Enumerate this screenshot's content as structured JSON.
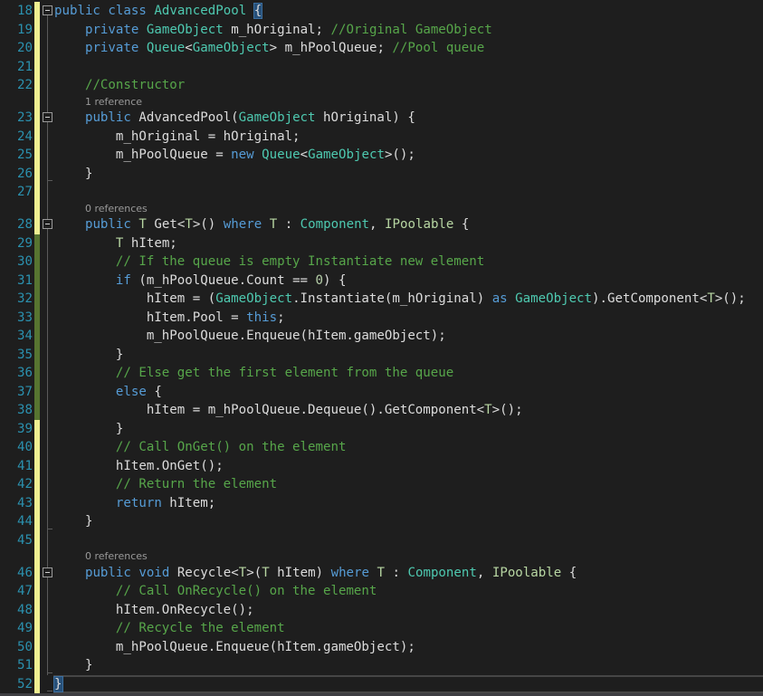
{
  "colors": {
    "keyword": "#569cd6",
    "type": "#4ec9b0",
    "type_param": "#b8d7a3",
    "comment": "#57a64a",
    "number": "#b5cea8",
    "text": "#dcdcdc",
    "line_number": "#2b91af",
    "margin_changed": "#efef91",
    "margin_saved": "#577430"
  },
  "lines": [
    {
      "n": "18",
      "m": "y",
      "fold": "box",
      "t": [
        [
          "kw",
          "public"
        ],
        [
          "",
          " "
        ],
        [
          "kw",
          "class"
        ],
        [
          "",
          " "
        ],
        [
          "ty",
          "AdvancedPool"
        ],
        [
          "",
          " "
        ],
        [
          "hl",
          "{"
        ]
      ]
    },
    {
      "n": "19",
      "m": "y",
      "t": [
        [
          "",
          "    "
        ],
        [
          "kw",
          "private"
        ],
        [
          "",
          " "
        ],
        [
          "ty",
          "GameObject"
        ],
        [
          "",
          " m_hOriginal; "
        ],
        [
          "cm",
          "//Original GameObject"
        ]
      ]
    },
    {
      "n": "20",
      "m": "y",
      "t": [
        [
          "",
          "    "
        ],
        [
          "kw",
          "private"
        ],
        [
          "",
          " "
        ],
        [
          "ty",
          "Queue"
        ],
        [
          "",
          "<"
        ],
        [
          "ty",
          "GameObject"
        ],
        [
          "",
          "> m_hPoolQueue; "
        ],
        [
          "cm",
          "//Pool queue"
        ]
      ]
    },
    {
      "n": "21",
      "m": "y",
      "t": []
    },
    {
      "n": "22",
      "m": "y",
      "t": [
        [
          "",
          "    "
        ],
        [
          "cm",
          "//Constructor"
        ]
      ]
    },
    {
      "ref": "1 reference",
      "m": "y"
    },
    {
      "n": "23",
      "m": "y",
      "fold": "box",
      "t": [
        [
          "",
          "    "
        ],
        [
          "kw",
          "public"
        ],
        [
          "",
          " AdvancedPool("
        ],
        [
          "ty",
          "GameObject"
        ],
        [
          "",
          " hOriginal) {"
        ]
      ]
    },
    {
      "n": "24",
      "m": "y",
      "t": [
        [
          "",
          "        m_hOriginal = hOriginal;"
        ]
      ]
    },
    {
      "n": "25",
      "m": "y",
      "t": [
        [
          "",
          "        m_hPoolQueue = "
        ],
        [
          "kw",
          "new"
        ],
        [
          "",
          " "
        ],
        [
          "ty",
          "Queue"
        ],
        [
          "",
          "<"
        ],
        [
          "ty",
          "GameObject"
        ],
        [
          "",
          ">();"
        ]
      ]
    },
    {
      "n": "26",
      "m": "y",
      "fold": "end",
      "t": [
        [
          "",
          "    }"
        ]
      ]
    },
    {
      "n": "27",
      "m": "y",
      "t": []
    },
    {
      "ref": "0 references",
      "m": "y"
    },
    {
      "n": "28",
      "m": "y",
      "fold": "box",
      "t": [
        [
          "",
          "    "
        ],
        [
          "kw",
          "public"
        ],
        [
          "",
          " "
        ],
        [
          "tp",
          "T"
        ],
        [
          "",
          " Get<"
        ],
        [
          "tp",
          "T"
        ],
        [
          "",
          ">() "
        ],
        [
          "kw",
          "where"
        ],
        [
          "",
          " "
        ],
        [
          "tp",
          "T"
        ],
        [
          "",
          " : "
        ],
        [
          "ty",
          "Component"
        ],
        [
          "",
          ", "
        ],
        [
          "tp",
          "IPoolable"
        ],
        [
          "",
          " {"
        ]
      ]
    },
    {
      "n": "29",
      "m": "g",
      "t": [
        [
          "",
          "        "
        ],
        [
          "tp",
          "T"
        ],
        [
          "",
          " hItem;"
        ]
      ]
    },
    {
      "n": "30",
      "m": "g",
      "t": [
        [
          "",
          "        "
        ],
        [
          "cm",
          "// If the queue is empty Instantiate new element"
        ]
      ]
    },
    {
      "n": "31",
      "m": "g",
      "t": [
        [
          "",
          "        "
        ],
        [
          "kw",
          "if"
        ],
        [
          "",
          " (m_hPoolQueue.Count == "
        ],
        [
          "nu",
          "0"
        ],
        [
          "",
          ") {"
        ]
      ]
    },
    {
      "n": "32",
      "m": "g",
      "t": [
        [
          "",
          "            hItem = ("
        ],
        [
          "ty",
          "GameObject"
        ],
        [
          "",
          ".Instantiate(m_hOriginal) "
        ],
        [
          "kw",
          "as"
        ],
        [
          "",
          " "
        ],
        [
          "ty",
          "GameObject"
        ],
        [
          "",
          ").GetComponent<"
        ],
        [
          "tp",
          "T"
        ],
        [
          "",
          ">();"
        ]
      ]
    },
    {
      "n": "33",
      "m": "g",
      "t": [
        [
          "",
          "            hItem.Pool = "
        ],
        [
          "kw",
          "this"
        ],
        [
          "",
          ";"
        ]
      ]
    },
    {
      "n": "34",
      "m": "g",
      "t": [
        [
          "",
          "            m_hPoolQueue.Enqueue(hItem.gameObject);"
        ]
      ]
    },
    {
      "n": "35",
      "m": "g",
      "t": [
        [
          "",
          "        }"
        ]
      ]
    },
    {
      "n": "36",
      "m": "g",
      "t": [
        [
          "",
          "        "
        ],
        [
          "cm",
          "// Else get the first element from the queue"
        ]
      ]
    },
    {
      "n": "37",
      "m": "g",
      "t": [
        [
          "",
          "        "
        ],
        [
          "kw",
          "else"
        ],
        [
          "",
          " {"
        ]
      ]
    },
    {
      "n": "38",
      "m": "g",
      "t": [
        [
          "",
          "            hItem = m_hPoolQueue.Dequeue().GetComponent<"
        ],
        [
          "tp",
          "T"
        ],
        [
          "",
          ">();"
        ]
      ]
    },
    {
      "n": "39",
      "m": "y",
      "t": [
        [
          "",
          "        }"
        ]
      ]
    },
    {
      "n": "40",
      "m": "y",
      "t": [
        [
          "",
          "        "
        ],
        [
          "cm",
          "// Call OnGet() on the element"
        ]
      ]
    },
    {
      "n": "41",
      "m": "y",
      "t": [
        [
          "",
          "        hItem.OnGet();"
        ]
      ]
    },
    {
      "n": "42",
      "m": "y",
      "t": [
        [
          "",
          "        "
        ],
        [
          "cm",
          "// Return the element"
        ]
      ]
    },
    {
      "n": "43",
      "m": "y",
      "t": [
        [
          "",
          "        "
        ],
        [
          "kw",
          "return"
        ],
        [
          "",
          " hItem;"
        ]
      ]
    },
    {
      "n": "44",
      "m": "y",
      "fold": "end",
      "t": [
        [
          "",
          "    }"
        ]
      ]
    },
    {
      "n": "45",
      "m": "y",
      "t": []
    },
    {
      "ref": "0 references",
      "m": "y"
    },
    {
      "n": "46",
      "m": "y",
      "fold": "box",
      "t": [
        [
          "",
          "    "
        ],
        [
          "kw",
          "public"
        ],
        [
          "",
          " "
        ],
        [
          "kw",
          "void"
        ],
        [
          "",
          " Recycle<"
        ],
        [
          "tp",
          "T"
        ],
        [
          "",
          ">("
        ],
        [
          "tp",
          "T"
        ],
        [
          "",
          " hItem) "
        ],
        [
          "kw",
          "where"
        ],
        [
          "",
          " "
        ],
        [
          "tp",
          "T"
        ],
        [
          "",
          " : "
        ],
        [
          "ty",
          "Component"
        ],
        [
          "",
          ", "
        ],
        [
          "tp",
          "IPoolable"
        ],
        [
          "",
          " {"
        ]
      ]
    },
    {
      "n": "47",
      "m": "y",
      "t": [
        [
          "",
          "        "
        ],
        [
          "cm",
          "// Call OnRecycle() on the element"
        ]
      ]
    },
    {
      "n": "48",
      "m": "y",
      "t": [
        [
          "",
          "        hItem.OnRecycle();"
        ]
      ]
    },
    {
      "n": "49",
      "m": "y",
      "t": [
        [
          "",
          "        "
        ],
        [
          "cm",
          "// Recycle the element"
        ]
      ]
    },
    {
      "n": "50",
      "m": "y",
      "t": [
        [
          "",
          "        m_hPoolQueue.Enqueue(hItem.gameObject);"
        ]
      ]
    },
    {
      "n": "51",
      "m": "y",
      "fold": "end",
      "t": [
        [
          "",
          "    }"
        ]
      ]
    },
    {
      "n": "52",
      "m": "y",
      "cur": true,
      "t": [
        [
          "hl",
          "}"
        ]
      ]
    }
  ]
}
